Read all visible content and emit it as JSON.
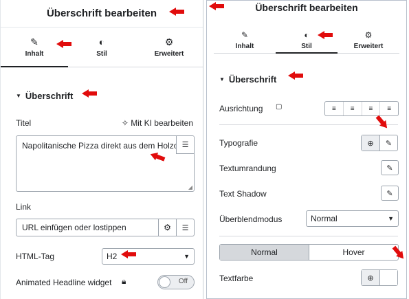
{
  "left": {
    "title": "Überschrift bearbeiten",
    "tabs": [
      {
        "label": "Inhalt",
        "icon": "pencil-icon"
      },
      {
        "label": "Stil",
        "icon": "contrast-icon"
      },
      {
        "label": "Erweitert",
        "icon": "gear-icon"
      }
    ],
    "section": "Überschrift",
    "title_label": "Titel",
    "ai_edit": "Mit KI bearbeiten",
    "title_value": "Napolitanische Pizza direkt aus dem Holzofen",
    "link_label": "Link",
    "link_placeholder": "URL einfügen oder lostippen",
    "html_tag_label": "HTML-Tag",
    "html_tag_value": "H2",
    "animated_label": "Animated Headline widget",
    "toggle_label": "Off"
  },
  "right": {
    "title": "Überschrift bearbeiten",
    "tabs": [
      {
        "label": "Inhalt",
        "icon": "pencil-icon"
      },
      {
        "label": "Stil",
        "icon": "contrast-icon"
      },
      {
        "label": "Erweitert",
        "icon": "gear-icon"
      }
    ],
    "section": "Überschrift",
    "alignment_label": "Ausrichtung",
    "typography_label": "Typografie",
    "border_label": "Textumrandung",
    "shadow_label": "Text Shadow",
    "blend_label": "Überblendmodus",
    "blend_value": "Normal",
    "state_normal": "Normal",
    "state_hover": "Hover",
    "color_label": "Textfarbe"
  },
  "colors": {
    "accent_arrow": "#e10c0c",
    "text": "#1f2124",
    "border": "#9da5ae"
  }
}
